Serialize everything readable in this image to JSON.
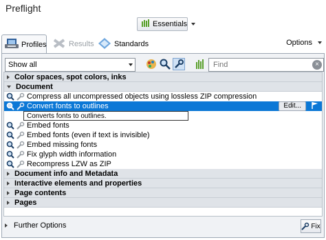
{
  "window": {
    "title": "Preflight"
  },
  "header": {
    "essentials_label": "Essentials"
  },
  "tabs": [
    {
      "label": "Profiles",
      "state": "active",
      "icon": "profiles-icon"
    },
    {
      "label": "Results",
      "state": "disabled",
      "icon": "results-icon"
    },
    {
      "label": "Standards",
      "state": "normal",
      "icon": "standards-icon"
    }
  ],
  "options_label": "Options",
  "toolbar": {
    "filter_value": "Show all",
    "search_placeholder": "Find"
  },
  "groups": {
    "color": {
      "label": "Color spaces, spot colors, inks",
      "expanded": false
    },
    "document": {
      "label": "Document",
      "expanded": true
    },
    "docinfo": {
      "label": "Document info and Metadata",
      "expanded": false
    },
    "interactive": {
      "label": "Interactive elements and properties",
      "expanded": false
    },
    "pagecontents": {
      "label": "Page contents",
      "expanded": false
    },
    "pages": {
      "label": "Pages",
      "expanded": false
    }
  },
  "document_items": [
    {
      "label": "Compress all uncompressed objects using lossless ZIP compression"
    },
    {
      "label": "Convert fonts to outlines",
      "selected": true,
      "edit_label": "Edit...",
      "description": "Converts fonts to outlines."
    },
    {
      "label": "Embed fonts"
    },
    {
      "label": "Embed fonts (even if text is invisible)"
    },
    {
      "label": "Embed missing fonts"
    },
    {
      "label": "Fix glyph width information"
    },
    {
      "label": "Recompress LZW as ZIP"
    }
  ],
  "footer": {
    "further_options": "Further Options",
    "fix_label": "Fix"
  },
  "colors": {
    "selection": "#0c78d6",
    "group_header": "#dfe3e8"
  }
}
